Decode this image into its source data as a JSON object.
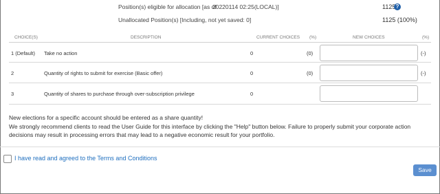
{
  "allocation": {
    "eligible_label": "Position(s) eligible for allocation [as of",
    "eligible_date": "20220114 02:25(LOCAL)]",
    "eligible_value": "1125",
    "unallocated_label": "Unallocated Position(s) [Including, not yet saved: 0]",
    "unallocated_value": "1125 (100%)",
    "help_glyph": "?"
  },
  "table": {
    "headers": {
      "choices": "CHOICE(S)",
      "description": "DESCRIPTION",
      "current": "CURRENT CHOICES",
      "pct1": "(%)",
      "new": "NEW CHOICES",
      "pct2": "(%)"
    },
    "rows": [
      {
        "choice": "1 (Default)",
        "description": "Take no action",
        "current": "0",
        "pct": "(0)",
        "new_pct": "(-)"
      },
      {
        "choice": "2",
        "description": "Quantity of rights to submit for exercise (Basic offer)",
        "current": "0",
        "pct": "(0)",
        "new_pct": "(-)"
      },
      {
        "choice": "3",
        "description": "Quantity of shares to purchase through over-subscription privilege",
        "current": "0",
        "pct": "",
        "new_pct": ""
      }
    ]
  },
  "notes": {
    "line1": "New elections for a specific account should be entered as a share quantity!",
    "line2": "We strongly recommend clients to read the User Guide for this interface by clicking the \"Help\" button below. Failure to properly submit your corporate action decisions may result in processing errors that may lead to a negative economic result for your portfolio."
  },
  "terms": {
    "label": "I have read and agreed to the Terms and Conditions",
    "checked": false
  },
  "actions": {
    "save_label": "Save"
  },
  "colors": {
    "accent": "#1f6fbf",
    "save_button": "#5b8fd0",
    "help_icon": "#1f5fa8"
  }
}
